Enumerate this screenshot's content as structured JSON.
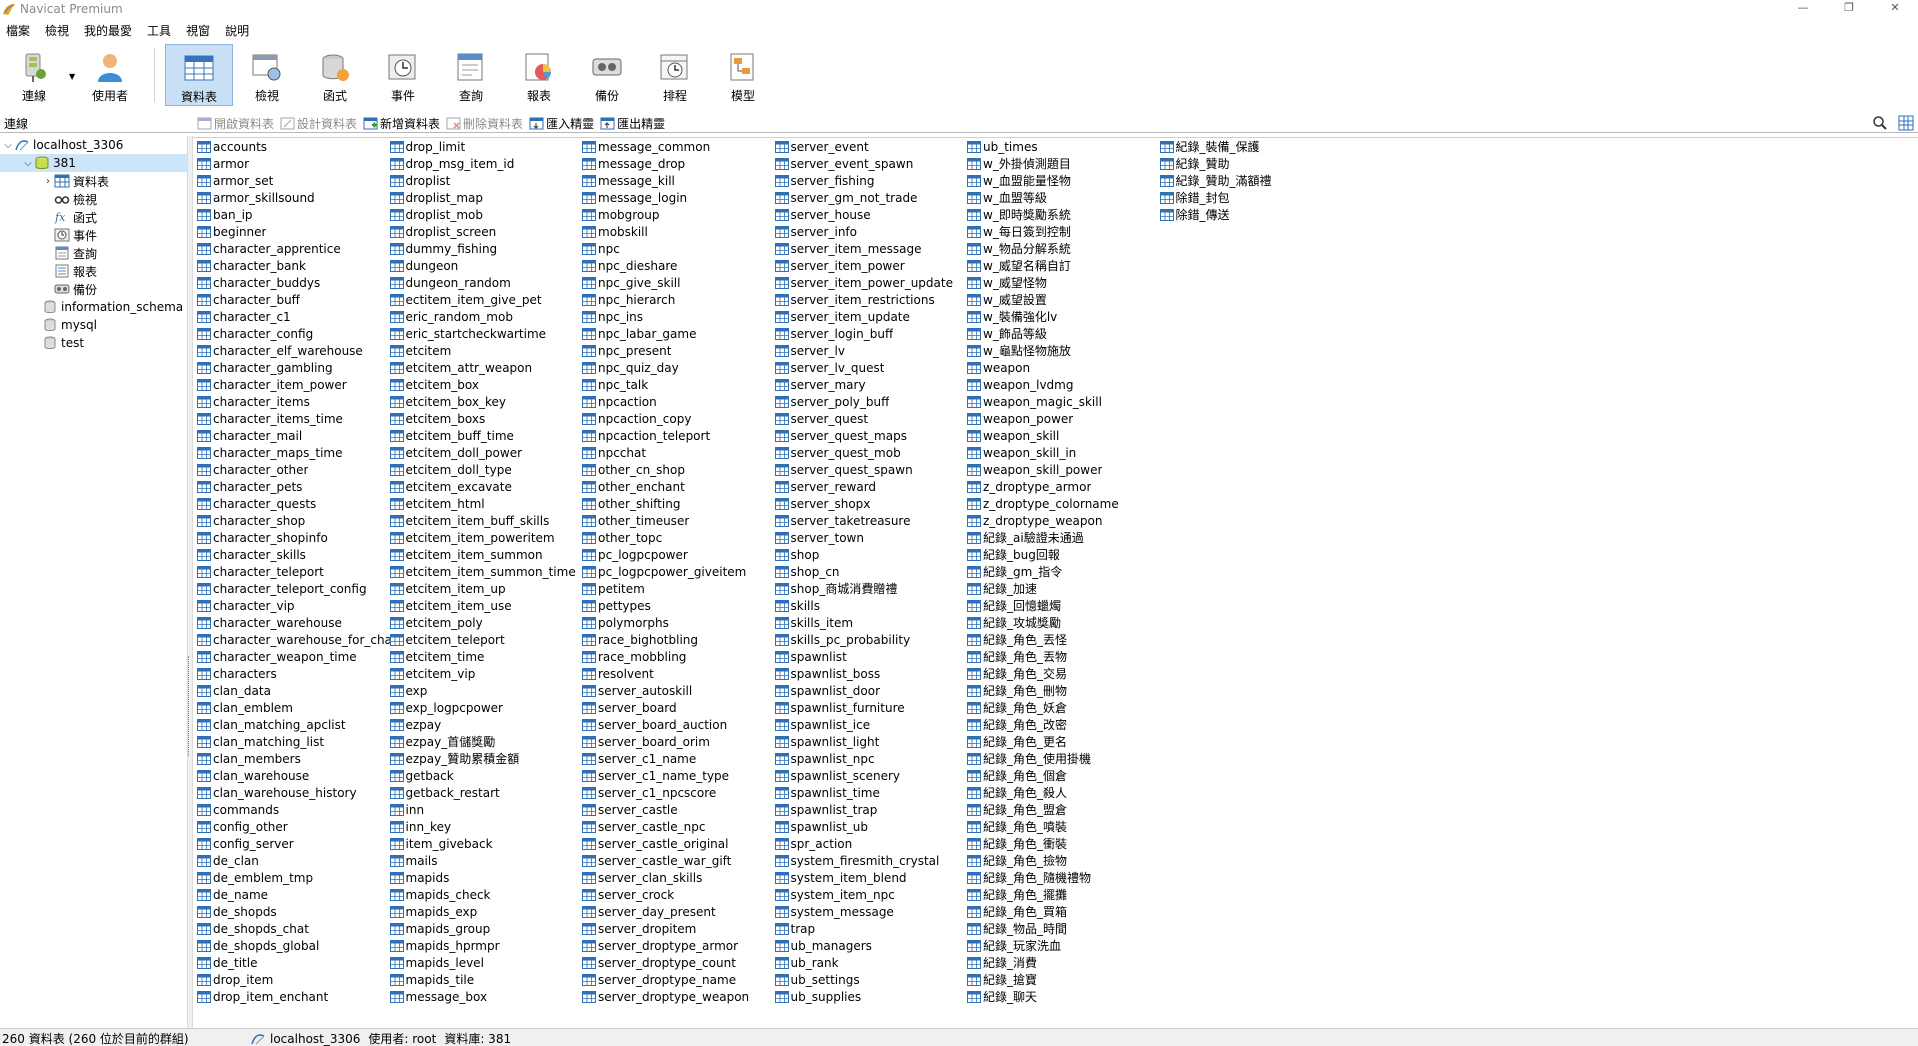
{
  "window": {
    "title": "Navicat Premium",
    "controls": {
      "minimize": "—",
      "maximize": "❐",
      "close": "✕"
    }
  },
  "menu": [
    "檔案",
    "檢視",
    "我的最愛",
    "工具",
    "視窗",
    "說明"
  ],
  "toolbar": {
    "connect": "連線",
    "user": "使用者",
    "table": "資料表",
    "view": "檢視",
    "function": "函式",
    "event": "事件",
    "query": "查詢",
    "report": "報表",
    "backup": "備份",
    "schedule": "排程",
    "model": "模型"
  },
  "subbar": {
    "connection_label": "連線",
    "open_table": "開啟資料表",
    "design_table": "設計資料表",
    "new_table": "新增資料表",
    "delete_table": "刪除資料表",
    "import_wizard": "匯入精靈",
    "export_wizard": "匯出精靈"
  },
  "tree": {
    "connection": "localhost_3306",
    "database": "381",
    "nodes": {
      "tables": "資料表",
      "views": "檢視",
      "functions": "函式",
      "events": "事件",
      "queries": "查詢",
      "reports": "報表",
      "backups": "備份"
    },
    "other_databases": [
      "information_schema",
      "mysql",
      "test"
    ]
  },
  "tables": {
    "columns": [
      [
        "accounts",
        "armor",
        "armor_set",
        "armor_skillsound",
        "ban_ip",
        "beginner",
        "character_apprentice",
        "character_bank",
        "character_buddys",
        "character_buff",
        "character_c1",
        "character_config",
        "character_elf_warehouse",
        "character_gambling",
        "character_item_power",
        "character_items",
        "character_items_time",
        "character_mail",
        "character_maps_time",
        "character_other",
        "character_pets",
        "character_quests",
        "character_shop",
        "character_shopinfo",
        "character_skills",
        "character_teleport",
        "character_teleport_config",
        "character_vip",
        "character_warehouse",
        "character_warehouse_for_cha",
        "character_weapon_time",
        "characters",
        "clan_data",
        "clan_emblem",
        "clan_matching_apclist",
        "clan_matching_list",
        "clan_members",
        "clan_warehouse",
        "clan_warehouse_history",
        "commands",
        "config_other",
        "config_server",
        "de_clan",
        "de_emblem_tmp",
        "de_name",
        "de_shopds",
        "de_shopds_chat",
        "de_shopds_global",
        "de_title",
        "drop_item",
        "drop_item_enchant"
      ],
      [
        "drop_limit",
        "drop_msg_item_id",
        "droplist",
        "droplist_map",
        "droplist_mob",
        "droplist_screen",
        "dummy_fishing",
        "dungeon",
        "dungeon_random",
        "ectitem_item_give_pet",
        "eric_random_mob",
        "eric_startcheckwartime",
        "etcitem",
        "etcitem_attr_weapon",
        "etcitem_box",
        "etcitem_box_key",
        "etcitem_boxs",
        "etcitem_buff_time",
        "etcitem_doll_power",
        "etcitem_doll_type",
        "etcitem_excavate",
        "etcitem_html",
        "etcitem_item_buff_skills",
        "etcitem_item_poweritem",
        "etcitem_item_summon",
        "etcitem_item_summon_time",
        "etcitem_item_up",
        "etcitem_item_use",
        "etcitem_poly",
        "etcitem_teleport",
        "etcitem_time",
        "etcitem_vip",
        "exp",
        "exp_logpcpower",
        "ezpay",
        "ezpay_首儲獎勵",
        "ezpay_贊助累積金額",
        "getback",
        "getback_restart",
        "inn",
        "inn_key",
        "item_giveback",
        "mails",
        "mapids",
        "mapids_check",
        "mapids_exp",
        "mapids_group",
        "mapids_hprmpr",
        "mapids_level",
        "mapids_tile",
        "message_box"
      ],
      [
        "message_common",
        "message_drop",
        "message_kill",
        "message_login",
        "mobgroup",
        "mobskill",
        "npc",
        "npc_dieshare",
        "npc_give_skill",
        "npc_hierarch",
        "npc_ins",
        "npc_labar_game",
        "npc_present",
        "npc_quiz_day",
        "npc_talk",
        "npcaction",
        "npcaction_copy",
        "npcaction_teleport",
        "npcchat",
        "other_cn_shop",
        "other_enchant",
        "other_shifting",
        "other_timeuser",
        "other_topc",
        "pc_logpcpower",
        "pc_logpcpower_giveitem",
        "petitem",
        "pettypes",
        "polymorphs",
        "race_bighotbling",
        "race_mobbling",
        "resolvent",
        "server_autoskill",
        "server_board",
        "server_board_auction",
        "server_board_orim",
        "server_c1_name",
        "server_c1_name_type",
        "server_c1_npcscore",
        "server_castle",
        "server_castle_npc",
        "server_castle_original",
        "server_castle_war_gift",
        "server_clan_skills",
        "server_crock",
        "server_day_present",
        "server_dropitem",
        "server_droptype_armor",
        "server_droptype_count",
        "server_droptype_name",
        "server_droptype_weapon"
      ],
      [
        "server_event",
        "server_event_spawn",
        "server_fishing",
        "server_gm_not_trade",
        "server_house",
        "server_info",
        "server_item_message",
        "server_item_power",
        "server_item_power_update",
        "server_item_restrictions",
        "server_item_update",
        "server_login_buff",
        "server_lv",
        "server_lv_quest",
        "server_mary",
        "server_poly_buff",
        "server_quest",
        "server_quest_maps",
        "server_quest_mob",
        "server_quest_spawn",
        "server_reward",
        "server_shopx",
        "server_taketreasure",
        "server_town",
        "shop",
        "shop_cn",
        "shop_商城消費贈禮",
        "skills",
        "skills_item",
        "skills_pc_probability",
        "spawnlist",
        "spawnlist_boss",
        "spawnlist_door",
        "spawnlist_furniture",
        "spawnlist_ice",
        "spawnlist_light",
        "spawnlist_npc",
        "spawnlist_scenery",
        "spawnlist_time",
        "spawnlist_trap",
        "spawnlist_ub",
        "spr_action",
        "system_firesmith_crystal",
        "system_item_blend",
        "system_item_npc",
        "system_message",
        "trap",
        "ub_managers",
        "ub_rank",
        "ub_settings",
        "ub_supplies"
      ],
      [
        "ub_times",
        "w_外掛偵測題目",
        "w_血盟能量怪物",
        "w_血盟等級",
        "w_即時獎勵系統",
        "w_每日簽到控制",
        "w_物品分解系統",
        "w_威望名稱自訂",
        "w_威望怪物",
        "w_威望設置",
        "w_裝備強化lv",
        "w_飾品等級",
        "w_龜點怪物施放",
        "weapon",
        "weapon_lvdmg",
        "weapon_magic_skill",
        "weapon_power",
        "weapon_skill",
        "weapon_skill_in",
        "weapon_skill_power",
        "z_droptype_armor",
        "z_droptype_colorname",
        "z_droptype_weapon",
        "紀錄_ai驗證未通過",
        "紀錄_bug回報",
        "紀錄_gm_指令",
        "紀錄_加速",
        "紀錄_回憶蠟燭",
        "紀錄_攻城獎勵",
        "紀錄_角色_丟怪",
        "紀錄_角色_丟物",
        "紀錄_角色_交易",
        "紀錄_角色_刪物",
        "紀錄_角色_妖倉",
        "紀錄_角色_改密",
        "紀錄_角色_更名",
        "紀錄_角色_使用掛機",
        "紀錄_角色_個倉",
        "紀錄_角色_殺人",
        "紀錄_角色_盟倉",
        "紀錄_角色_噴裝",
        "紀錄_角色_衝裝",
        "紀錄_角色_撿物",
        "紀錄_角色_隨機禮物",
        "紀錄_角色_擺攤",
        "紀錄_角色_買箱",
        "紀錄_物品_時間",
        "紀錄_玩家洗血",
        "紀錄_消費",
        "紀錄_搶寶",
        "紀錄_聊天"
      ],
      [
        "紀錄_裝備_保護",
        "紀錄_贊助",
        "紀錄_贊助_滿額禮",
        "除錯_封包",
        "除錯_傳送"
      ]
    ]
  },
  "status": {
    "summary": "260 資料表 (260 位於目前的群組)",
    "connection": "localhost_3306",
    "user": "使用者: root",
    "database": "資料庫: 381"
  },
  "colors": {
    "active_toolbar": "#c8dff5",
    "selected_tree": "#cde5f9",
    "table_icon": "#2f6fb5"
  }
}
